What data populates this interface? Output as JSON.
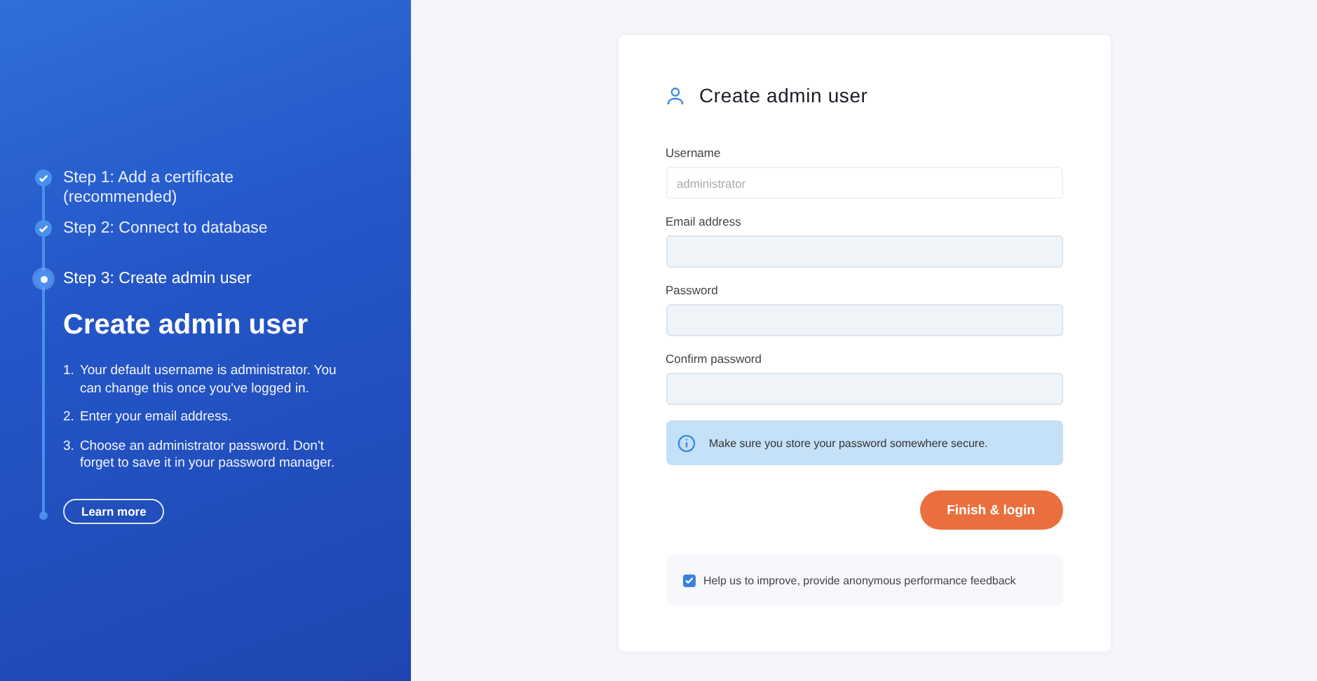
{
  "sidebar": {
    "steps": [
      {
        "label": "Step 1: Add a certificate (recommended)",
        "completed": true,
        "selected": false
      },
      {
        "label": "Step 2: Connect to database",
        "completed": true,
        "selected": false
      },
      {
        "label": "Step 3: Create admin user",
        "completed": false,
        "selected": true
      }
    ],
    "heading": "Create admin user",
    "instructions": [
      {
        "number": "1.",
        "text": "Your default username is administrator. You can change this once you've logged in."
      },
      {
        "number": "2.",
        "text": "Enter your email address."
      },
      {
        "number": "3.",
        "text": "Choose an administrator password. Don't forget to save it in your password manager."
      }
    ],
    "learn_more": "Learn more"
  },
  "form": {
    "title": "Create admin user",
    "fields": [
      {
        "label": "Username",
        "value": "administrator",
        "disabled": true
      },
      {
        "label": "Email address",
        "disabled": false
      },
      {
        "label": "Password",
        "disabled": false
      },
      {
        "label": "Confirm password",
        "disabled": false
      }
    ],
    "notice": "Make sure you store your password somewhere secure.",
    "submit": "Finish & login",
    "feedback": {
      "label": "Help us to improve, provide anonymous performance feedback",
      "checked": true
    }
  }
}
